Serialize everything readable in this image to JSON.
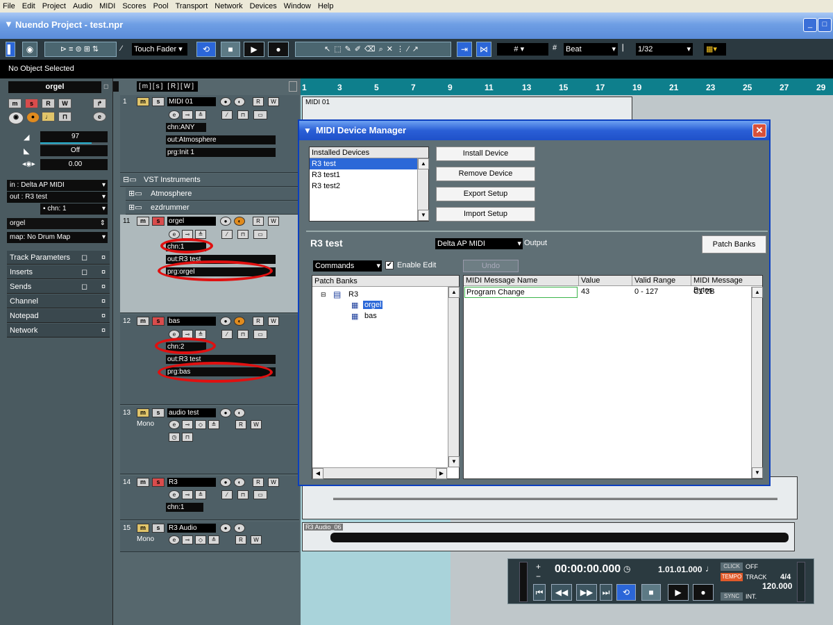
{
  "menubar": [
    "File",
    "Edit",
    "Project",
    "Audio",
    "MIDI",
    "Scores",
    "Pool",
    "Transport",
    "Network",
    "Devices",
    "Window",
    "Help"
  ],
  "window_title": "Nuendo Project - test.npr",
  "toolbar": {
    "automation_mode": "Touch Fader",
    "grid_type": "Beat",
    "quantize": "1/32"
  },
  "status": "No Object Selected",
  "inspector": {
    "track_name": "orgel",
    "volume": "97",
    "pan": "Off",
    "delay": "0.00",
    "input": "in : Delta AP MIDI",
    "output": "out : R3 test",
    "channel": "chn: 1",
    "program": "orgel",
    "drum_map": "map: No Drum Map",
    "sections": [
      "Track Parameters",
      "Inserts",
      "Sends",
      "Channel",
      "Notepad",
      "Network"
    ]
  },
  "tracks": {
    "t1": {
      "num": "1",
      "name": "MIDI 01",
      "chn": "chn:ANY",
      "out": "out:Atmosphere",
      "prg": "prg:Init 1"
    },
    "folder": "VST Instruments",
    "sub1": "Atmosphere",
    "sub2": "ezdrummer",
    "t11": {
      "num": "11",
      "name": "orgel",
      "chn": "chn:1",
      "out": "out:R3 test",
      "prg": "prg:orgel"
    },
    "t12": {
      "num": "12",
      "name": "bas",
      "chn": "chn:2",
      "out": "out:R3 test",
      "prg": "prg:bas"
    },
    "t13": {
      "num": "13",
      "name": "audio test",
      "mode": "Mono"
    },
    "t14": {
      "num": "14",
      "name": "R3",
      "chn": "chn:1"
    },
    "t15": {
      "num": "15",
      "name": "R3 Audio",
      "mode": "Mono"
    }
  },
  "ruler": [
    "1",
    "3",
    "5",
    "7",
    "9",
    "11",
    "13",
    "15",
    "17",
    "19",
    "21",
    "23",
    "25",
    "27",
    "29"
  ],
  "parts": {
    "midi": "MIDI 01",
    "audio": "R3 Audio_06"
  },
  "dialog": {
    "title": "MIDI Device Manager",
    "installed_header": "Installed Devices",
    "devices": [
      "R3 test",
      "R3 test1",
      "R3 test2"
    ],
    "buttons": [
      "Install Device",
      "Remove Device",
      "Export Setup",
      "Import Setup"
    ],
    "device_name": "R3 test",
    "output_port": "Delta AP MIDI",
    "output_label": "Output",
    "patch_banks_button": "Patch Banks",
    "commands": "Commands",
    "enable_edit": "Enable Edit",
    "undo": "Undo",
    "tree_header": "Patch Banks",
    "tree_root": "R3",
    "tree_items": [
      "orgel",
      "bas"
    ],
    "table_headers": [
      "MIDI Message Name",
      "Value",
      "Valid Range",
      "MIDI Message Bytes"
    ],
    "table_rows": [
      {
        "name": "Program Change",
        "value": "43",
        "range": "0 - 127",
        "bytes": "C1 2B"
      }
    ]
  },
  "transport": {
    "time": "00:00:00.000",
    "bars": "1.01.01.000",
    "click_label": "CLICK",
    "click_state": "OFF",
    "tempo_label": "TEMPO",
    "tempo_mode": "TRACK",
    "signature": "4/4",
    "tempo": "120.000",
    "sync_label": "SYNC",
    "sync_mode": "INT."
  }
}
